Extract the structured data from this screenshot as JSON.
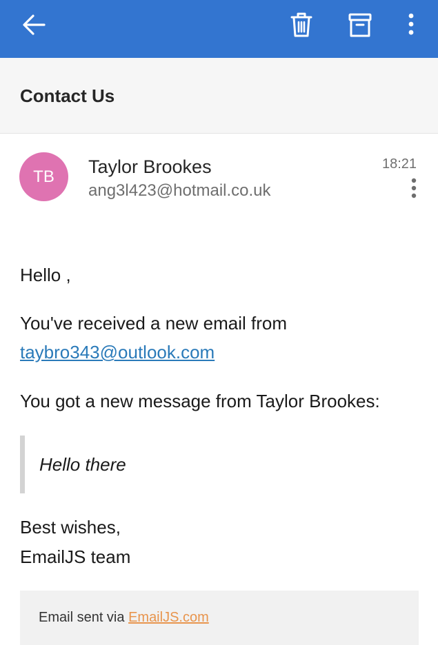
{
  "colors": {
    "appbar": "#3375d0",
    "avatar": "#df73b1",
    "link": "#2a7ab9",
    "footer_link": "#e8944c"
  },
  "appbar": {
    "icons": [
      "back-arrow-icon",
      "trash-icon",
      "archive-icon",
      "more-vert-icon"
    ]
  },
  "subject": "Contact Us",
  "message": {
    "avatar_initials": "TB",
    "sender_name": "Taylor Brookes",
    "sender_email": "ang3l423@hotmail.co.uk",
    "time": "18:21"
  },
  "body": {
    "greeting": "Hello ,",
    "received_line": "You've received a new email from",
    "from_email": "taybro343@outlook.com",
    "new_message_line": "You got a new message from Taylor Brookes:",
    "quote": "Hello there",
    "signoff": "Best wishes,",
    "team": "EmailJS team"
  },
  "footer": {
    "prefix": "Email sent via ",
    "link_text": "EmailJS.com"
  }
}
